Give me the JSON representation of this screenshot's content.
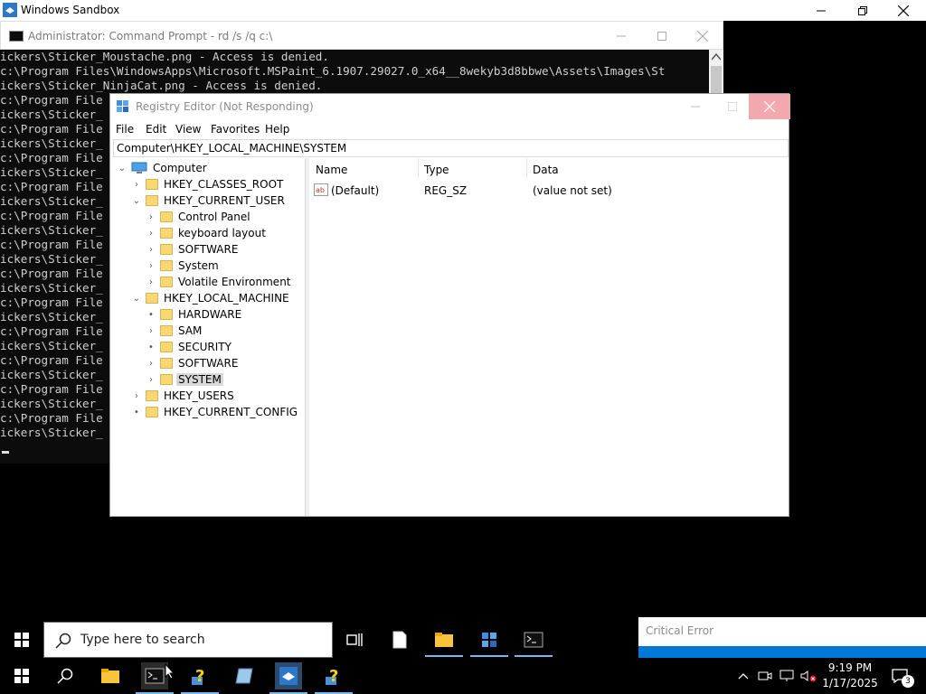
{
  "sandbox": {
    "title": "Windows Sandbox"
  },
  "cmd": {
    "title": "Administrator: Command Prompt - rd  /s /q c:\\",
    "lines": [
      "ickers\\Sticker_Moustache.png - Access is denied.",
      "c:\\Program Files\\WindowsApps\\Microsoft.MSPaint_6.1907.29027.0_x64__8wekyb3d8bbwe\\Assets\\Images\\St",
      "ickers\\Sticker_NinjaCat.png - Access is denied.",
      "c:\\Program File",
      "ickers\\Sticker_",
      "c:\\Program File",
      "ickers\\Sticker_",
      "c:\\Program File",
      "ickers\\Sticker_",
      "c:\\Program File",
      "ickers\\Sticker_",
      "c:\\Program File",
      "ickers\\Sticker_",
      "c:\\Program File",
      "ickers\\Sticker_",
      "c:\\Program File",
      "ickers\\Sticker_",
      "c:\\Program File",
      "ickers\\Sticker_",
      "c:\\Program File",
      "ickers\\Sticker_",
      "c:\\Program File",
      "ickers\\Sticker_",
      "c:\\Program File",
      "ickers\\Sticker_",
      "c:\\Program File",
      "ickers\\Sticker_"
    ]
  },
  "regedit": {
    "title": "Registry Editor (Not Responding)",
    "menu": [
      "File",
      "Edit",
      "View",
      "Favorites",
      "Help"
    ],
    "address": "Computer\\HKEY_LOCAL_MACHINE\\SYSTEM",
    "tree": {
      "computer": "Computer",
      "classes_root": "HKEY_CLASSES_ROOT",
      "current_user": "HKEY_CURRENT_USER",
      "cu_children": [
        "Control Panel",
        "keyboard layout",
        "SOFTWARE",
        "System",
        "Volatile Environment"
      ],
      "local_machine": "HKEY_LOCAL_MACHINE",
      "lm_children": [
        "HARDWARE",
        "SAM",
        "SECURITY",
        "SOFTWARE",
        "SYSTEM"
      ],
      "users": "HKEY_USERS",
      "current_config": "HKEY_CURRENT_CONFIG"
    },
    "columns": {
      "name": "Name",
      "type": "Type",
      "data": "Data"
    },
    "values": [
      {
        "name": "(Default)",
        "type": "REG_SZ",
        "data": "(value not set)"
      }
    ]
  },
  "search": {
    "placeholder": "Type here to search"
  },
  "toast": {
    "title": "Critical Error"
  },
  "tray": {
    "time": "9:19 PM",
    "date": "1/17/2025",
    "notifications": "3"
  },
  "colors": {
    "accent": "#0078d7",
    "close_hover": "#f1a8ae",
    "folder": "#f8d775"
  }
}
